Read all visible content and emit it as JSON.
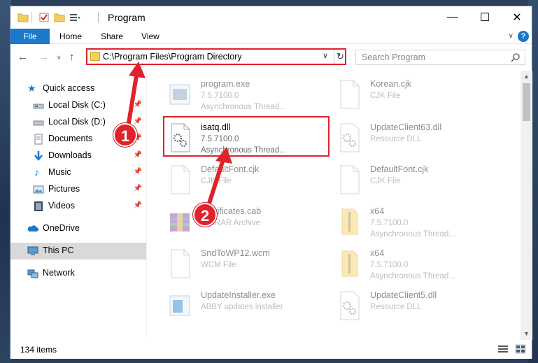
{
  "window": {
    "title": "Program"
  },
  "ribbon": {
    "tabs": [
      "File",
      "Home",
      "Share",
      "View"
    ],
    "help": "?"
  },
  "address": {
    "path": "C:\\Program Files\\Program Directory"
  },
  "search": {
    "placeholder": "Search Program"
  },
  "sidebar": {
    "items": [
      {
        "label": "Quick access",
        "icon": "star-icon"
      },
      {
        "label": "Local Disk (C:)",
        "icon": "drive-icon",
        "pinned": true
      },
      {
        "label": "Local Disk (D:)",
        "icon": "drive-icon",
        "pinned": true
      },
      {
        "label": "Documents",
        "icon": "documents-icon",
        "pinned": true
      },
      {
        "label": "Downloads",
        "icon": "download-icon",
        "pinned": true
      },
      {
        "label": "Music",
        "icon": "music-icon",
        "pinned": true
      },
      {
        "label": "Pictures",
        "icon": "pictures-icon",
        "pinned": true
      },
      {
        "label": "Videos",
        "icon": "videos-icon",
        "pinned": true
      },
      {
        "label": "OneDrive",
        "icon": "cloud-icon"
      },
      {
        "label": "This PC",
        "icon": "pc-icon",
        "selected": true
      },
      {
        "label": "Network",
        "icon": "network-icon"
      }
    ]
  },
  "files": [
    {
      "name": "program.exe",
      "line2": "7.5.7100.0",
      "line3": "Asynchronous Thread...",
      "icon": "exe-icon",
      "faded": true
    },
    {
      "name": "Korean.cjk",
      "line2": "CJK File",
      "line3": "",
      "icon": "file-icon",
      "faded": true
    },
    {
      "name": "isatq.dll",
      "line2": "7.5.7100.0",
      "line3": "Asynchronous Thread...",
      "icon": "dll-gear-icon",
      "faded": false
    },
    {
      "name": "UpdateClient63.dll",
      "line2": "Resource DLL",
      "line3": "",
      "icon": "dll-gear-icon",
      "faded": true
    },
    {
      "name": "DefaultFont.cjk",
      "line2": "CJK File",
      "line3": "",
      "icon": "file-icon",
      "faded": true
    },
    {
      "name": "DefaultFont.cjk",
      "line2": "CJK File",
      "line3": "",
      "icon": "file-icon",
      "faded": true
    },
    {
      "name": "Certificates.cab",
      "line2": "WinRAR Archive",
      "line3": "",
      "icon": "archive-icon",
      "faded": true
    },
    {
      "name": "x64",
      "line2": "7.5.7100.0",
      "line3": "Asynchronous Thread...",
      "icon": "folder-zip-icon",
      "faded": true
    },
    {
      "name": "SndToWP12.wcm",
      "line2": "WCM File",
      "line3": "",
      "icon": "file-icon",
      "faded": true
    },
    {
      "name": "x64",
      "line2": "7.5.7100.0",
      "line3": "Asynchronous Thread...",
      "icon": "folder-zip-icon",
      "faded": true
    },
    {
      "name": "UpdateInstaller.exe",
      "line2": "ABBY updates installer",
      "line3": "",
      "icon": "installer-icon",
      "faded": true
    },
    {
      "name": "UpdateClient5.dll",
      "line2": "Resource DLL",
      "line3": "",
      "icon": "dll-gear-icon",
      "faded": true
    }
  ],
  "status": {
    "item_count": "134 items"
  },
  "annotations": {
    "step1": "1",
    "step2": "2"
  },
  "colors": {
    "accent": "#1979ca",
    "highlight": "#e0222b"
  }
}
